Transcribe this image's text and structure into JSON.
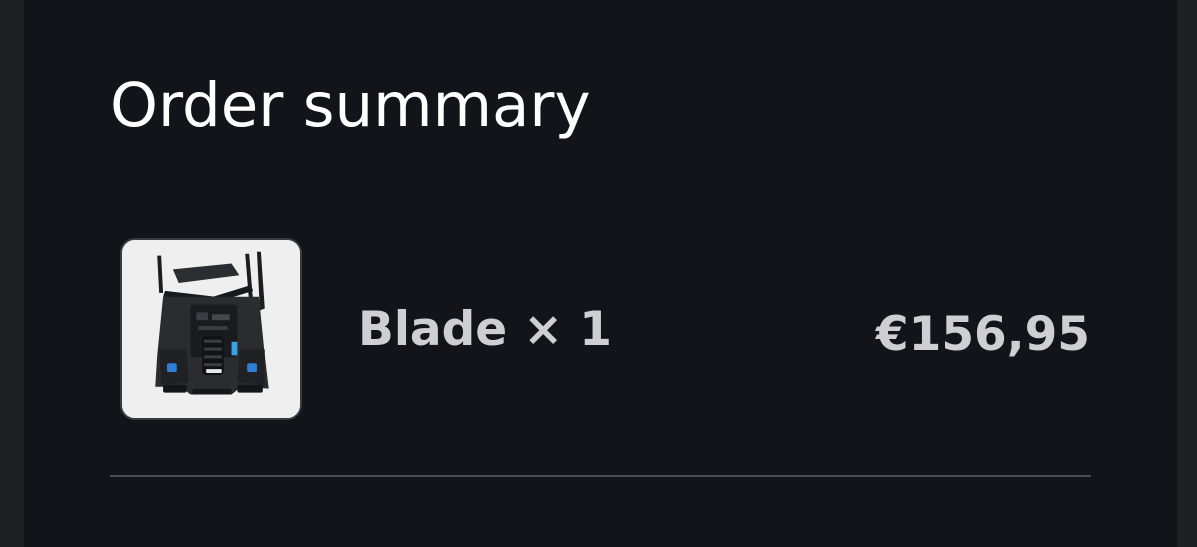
{
  "order_summary": {
    "title": "Order summary",
    "items": [
      {
        "name": "Blade",
        "quantity_text": "Blade × 1",
        "price": "€156,95",
        "thumbnail_icon": "robot-chassis-image"
      }
    ]
  },
  "colors": {
    "page_background": "#1e1f23",
    "panel_background": "#131419",
    "title_text": "#ffffff",
    "item_text": "#cfcfd3",
    "divider": "#4a4b50",
    "thumbnail_background": "#efefef"
  }
}
